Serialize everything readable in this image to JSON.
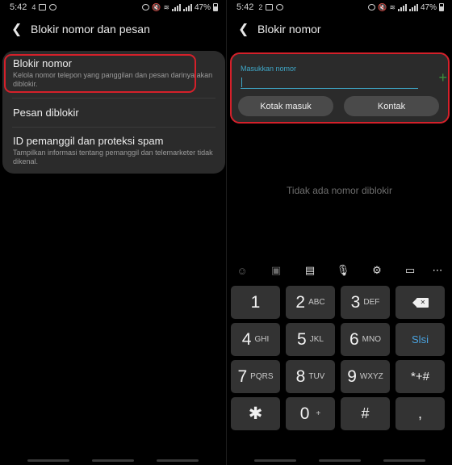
{
  "left": {
    "status": {
      "time": "5:42",
      "notif": "4",
      "battery": "47%"
    },
    "title": "Blokir nomor dan pesan",
    "items": [
      {
        "label": "Blokir nomor",
        "sub": "Kelola nomor telepon yang panggilan dan pesan darinya akan diblokir."
      },
      {
        "label": "Pesan diblokir"
      },
      {
        "label": "ID pemanggil dan proteksi spam",
        "sub": "Tampilkan informasi tentang pemanggil dan telemarketer tidak dikenal."
      }
    ]
  },
  "right": {
    "status": {
      "time": "5:42",
      "notif": "2",
      "battery": "47%"
    },
    "title": "Blokir nomor",
    "input_label": "Masukkan nomor",
    "input_value": "",
    "inbox_button": "Kotak masuk",
    "contacts_button": "Kontak",
    "empty_text": "Tidak ada nomor diblokir",
    "keys": [
      {
        "d": "1",
        "l": ""
      },
      {
        "d": "2",
        "l": "ABC"
      },
      {
        "d": "3",
        "l": "DEF"
      },
      {
        "d": "4",
        "l": "GHI"
      },
      {
        "d": "5",
        "l": "JKL"
      },
      {
        "d": "6",
        "l": "MNO"
      },
      {
        "d": "7",
        "l": "PQRS"
      },
      {
        "d": "8",
        "l": "TUV"
      },
      {
        "d": "9",
        "l": "WXYZ"
      },
      {
        "d": "0",
        "l": "+"
      }
    ],
    "next_key": "Slsi",
    "symbols_key": "*+#",
    "star_key": "✱",
    "hash_key": "#",
    "comma_key": ",",
    "accent": "#3fa8c8",
    "highlight": "#d5202a"
  }
}
